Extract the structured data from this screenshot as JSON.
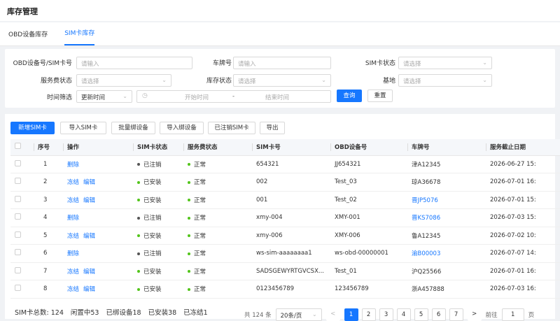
{
  "page_title": "库存管理",
  "tabs": [
    {
      "label": "OBD设备库存"
    },
    {
      "label": "SIM卡库存"
    }
  ],
  "filters": {
    "obd_sim_label": "OBD设备号/SIM卡号",
    "obd_sim_placeholder": "请输入",
    "plate_label": "车牌号",
    "plate_placeholder": "请输入",
    "sim_status_label": "SIM卡状态",
    "sim_status_placeholder": "请选择",
    "service_status_label": "服务费状态",
    "service_status_placeholder": "请选择",
    "stock_status_label": "库存状态",
    "stock_status_placeholder": "请选择",
    "base_label": "基地",
    "base_placeholder": "请选择",
    "time_label": "时间筛选",
    "time_type_value": "更新时间",
    "start_placeholder": "开始时间",
    "range_sep": "-",
    "end_placeholder": "结束时间",
    "query_label": "查询",
    "reset_label": "重置"
  },
  "toolbar": {
    "add": "新增SIM卡",
    "import_sim": "导入SIM卡",
    "batch_bind": "批量绑设备",
    "import_bind": "导入绑设备",
    "cancelled_sim": "已注销SIM卡",
    "export": "导出"
  },
  "table": {
    "headers": [
      "序号",
      "操作",
      "SIM卡状态",
      "服务费状态",
      "SIM卡号",
      "OBD设备号",
      "车牌号",
      "服务截止日期"
    ],
    "rows": [
      {
        "no": "1",
        "actions": [
          "删除"
        ],
        "sim_status": "已注销",
        "sim_status_color": "#555555",
        "service_status": "正常",
        "sim": "654321",
        "obd": "JJ654321",
        "plate": "津A12345",
        "plate_link": false,
        "date": "2026-06-27 15:"
      },
      {
        "no": "2",
        "actions": [
          "冻结",
          "编辑"
        ],
        "sim_status": "已安装",
        "sim_status_color": "#52c41a",
        "service_status": "正常",
        "sim": "002",
        "obd": "Test_03",
        "plate": "琼A36678",
        "plate_link": false,
        "date": "2026-07-01 16:"
      },
      {
        "no": "3",
        "actions": [
          "冻结",
          "编辑"
        ],
        "sim_status": "已安装",
        "sim_status_color": "#52c41a",
        "service_status": "正常",
        "sim": "001",
        "obd": "Test_02",
        "plate": "晋JP5076",
        "plate_link": true,
        "date": "2026-07-01 15:"
      },
      {
        "no": "4",
        "actions": [
          "删除"
        ],
        "sim_status": "已注销",
        "sim_status_color": "#555555",
        "service_status": "正常",
        "sim": "xmy-004",
        "obd": "XMY-001",
        "plate": "晋KS7086",
        "plate_link": true,
        "date": "2026-07-03 15:"
      },
      {
        "no": "5",
        "actions": [
          "冻结",
          "编辑"
        ],
        "sim_status": "已安装",
        "sim_status_color": "#52c41a",
        "service_status": "正常",
        "sim": "xmy-006",
        "obd": "XMY-006",
        "plate": "鲁A12345",
        "plate_link": false,
        "date": "2026-07-02 10:"
      },
      {
        "no": "6",
        "actions": [
          "删除"
        ],
        "sim_status": "已注销",
        "sim_status_color": "#555555",
        "service_status": "正常",
        "sim": "ws-sim-aaaaaaaa1",
        "obd": "ws-obd-00000001",
        "plate": "渝B00003",
        "plate_link": true,
        "date": "2026-07-07 14:"
      },
      {
        "no": "7",
        "actions": [
          "冻结",
          "编辑"
        ],
        "sim_status": "已安装",
        "sim_status_color": "#52c41a",
        "service_status": "正常",
        "sim": "SADSGEWYRTGVCSX...",
        "obd": "Test_01",
        "plate": "沪Q25566",
        "plate_link": false,
        "date": "2026-07-01 16:"
      },
      {
        "no": "8",
        "actions": [
          "冻结",
          "编辑"
        ],
        "sim_status": "已安装",
        "sim_status_color": "#52c41a",
        "service_status": "正常",
        "sim": "0123456789",
        "obd": "123456789",
        "plate": "浙A457888",
        "plate_link": false,
        "date": "2026-07-03 16:"
      }
    ]
  },
  "summary": {
    "total": "SIM卡总数: 124",
    "idle": "闲置中53",
    "bound": "已绑设备18",
    "installed": "已安装38",
    "frozen": "已冻结1"
  },
  "pagination": {
    "total": "共 124 条",
    "page_size": "20条/页",
    "prev": "<",
    "pages": [
      "1",
      "2",
      "3",
      "4",
      "5",
      "6",
      "7"
    ],
    "next": ">",
    "goto_label": "前往",
    "goto_value": "1",
    "goto_suffix": "页"
  },
  "colors": {
    "primary": "#1677ff",
    "installed": "#52c41a",
    "cancelled": "#555555",
    "normal": "#52c41a"
  }
}
